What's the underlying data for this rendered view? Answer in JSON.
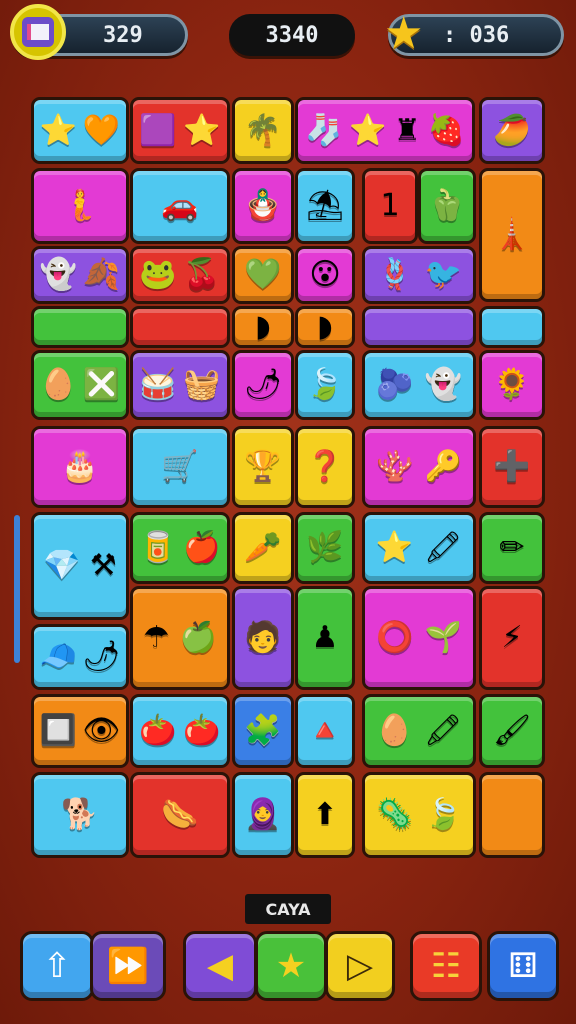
{
  "hud": {
    "left_value": "329",
    "center_value": "3340",
    "right_value": ": 036",
    "right_icon": "star-icon"
  },
  "bottom_label": "CAYA",
  "controls": {
    "home_icon": "⇧",
    "skip_icon": "⏩",
    "prev_icon": "◀",
    "star_icon": "★",
    "next_icon": "▷",
    "menu_icon": "☷",
    "dice_icon": "⚅"
  },
  "tiles": [
    {
      "name": "tile-stars-heart",
      "icons": [
        "⭐",
        "🧡"
      ]
    },
    {
      "name": "tile-gift-star",
      "icons": [
        "🟪",
        "⭐"
      ]
    },
    {
      "name": "tile-palm",
      "icons": [
        "🌴"
      ]
    },
    {
      "name": "tile-mixed-row1",
      "icons": [
        "🧦",
        "⭐",
        "♜",
        "🍓"
      ]
    },
    {
      "name": "tile-mango",
      "icons": [
        "🥭"
      ]
    },
    {
      "name": "tile-mermaid",
      "icons": [
        "🧜"
      ]
    },
    {
      "name": "tile-car",
      "icons": [
        "🚗"
      ]
    },
    {
      "name": "tile-figure",
      "icons": [
        "🪆"
      ]
    },
    {
      "name": "tile-umbrella",
      "icons": [
        "⛱"
      ]
    },
    {
      "name": "tile-number-one",
      "icons": [
        "1"
      ]
    },
    {
      "name": "tile-leaf-pod",
      "icons": [
        "🫑"
      ]
    },
    {
      "name": "tile-tower",
      "icons": [
        "🗼"
      ]
    },
    {
      "name": "tile-ghost-leaf",
      "icons": [
        "👻",
        "🍂"
      ]
    },
    {
      "name": "tile-frog-cherry",
      "icons": [
        "🐸",
        "🍒"
      ]
    },
    {
      "name": "tile-heart-green",
      "icons": [
        "💚"
      ]
    },
    {
      "name": "tile-face",
      "icons": [
        "😮"
      ]
    },
    {
      "name": "tile-knot-bird",
      "icons": [
        "🪢",
        "🐦"
      ]
    },
    {
      "name": "tile-bar-green",
      "icons": []
    },
    {
      "name": "tile-bar-red",
      "icons": []
    },
    {
      "name": "tile-bar-orange-a",
      "icons": [
        "◗"
      ]
    },
    {
      "name": "tile-bar-orange-b",
      "icons": [
        "◗"
      ]
    },
    {
      "name": "tile-bar-purple",
      "icons": []
    },
    {
      "name": "tile-bar-cyan",
      "icons": []
    },
    {
      "name": "tile-egg-box",
      "icons": [
        "🥚",
        "❎"
      ]
    },
    {
      "name": "tile-drum",
      "icons": [
        "🥁",
        "🧺"
      ]
    },
    {
      "name": "tile-radish",
      "icons": [
        "🌶"
      ]
    },
    {
      "name": "tile-leaf",
      "icons": [
        "🍃"
      ]
    },
    {
      "name": "tile-blob-ghost",
      "icons": [
        "🫐",
        "👻"
      ]
    },
    {
      "name": "tile-sunflower",
      "icons": [
        "🌻"
      ]
    },
    {
      "name": "tile-cake",
      "icons": [
        "🎂"
      ]
    },
    {
      "name": "tile-wheelbarrow",
      "icons": [
        "🛒"
      ]
    },
    {
      "name": "tile-lamp",
      "icons": [
        "🏆"
      ]
    },
    {
      "name": "tile-question",
      "icons": [
        "❓"
      ]
    },
    {
      "name": "tile-coral-key",
      "icons": [
        "🪸",
        "🔑"
      ]
    },
    {
      "name": "tile-plus",
      "icons": [
        "➕"
      ]
    },
    {
      "name": "tile-gem-tools",
      "icons": [
        "💎",
        "⚒"
      ]
    },
    {
      "name": "tile-can-apple",
      "icons": [
        "🥫",
        "🍎"
      ]
    },
    {
      "name": "tile-carrot",
      "icons": [
        "🥕"
      ]
    },
    {
      "name": "tile-fern",
      "icons": [
        "🌿"
      ]
    },
    {
      "name": "tile-star-crayon",
      "icons": [
        "⭐",
        "🖍"
      ]
    },
    {
      "name": "tile-pencil",
      "icons": [
        "✏"
      ]
    },
    {
      "name": "tile-umbrella-apple",
      "icons": [
        "☂",
        "🍏"
      ]
    },
    {
      "name": "tile-person",
      "icons": [
        "🧑"
      ]
    },
    {
      "name": "tile-pawn",
      "icons": [
        "♟"
      ]
    },
    {
      "name": "tile-ring-plant",
      "icons": [
        "⭕",
        "🌱"
      ]
    },
    {
      "name": "tile-lightning",
      "icons": [
        "⚡"
      ]
    },
    {
      "name": "tile-cap-pepper",
      "icons": [
        "🧢",
        "🌶"
      ]
    },
    {
      "name": "tile-letter-eye",
      "icons": [
        "🔲",
        "👁"
      ]
    },
    {
      "name": "tile-tomatoes",
      "icons": [
        "🍅",
        "🍅"
      ]
    },
    {
      "name": "tile-puzzle",
      "icons": [
        "🧩"
      ]
    },
    {
      "name": "tile-triangle",
      "icons": [
        "🔺"
      ]
    },
    {
      "name": "tile-egg-crayon",
      "icons": [
        "🥚",
        "🖍"
      ]
    },
    {
      "name": "tile-brush",
      "icons": [
        "🖌"
      ]
    },
    {
      "name": "tile-dog-frame",
      "icons": [
        "🐕"
      ]
    },
    {
      "name": "tile-food-plate",
      "icons": [
        "🌭"
      ]
    },
    {
      "name": "tile-doll",
      "icons": [
        "🧕"
      ]
    },
    {
      "name": "tile-arrow",
      "icons": [
        "⬆"
      ]
    },
    {
      "name": "tile-virus-leaf",
      "icons": [
        "🦠",
        "🍃"
      ]
    },
    {
      "name": "tile-empty-orange",
      "icons": []
    }
  ]
}
